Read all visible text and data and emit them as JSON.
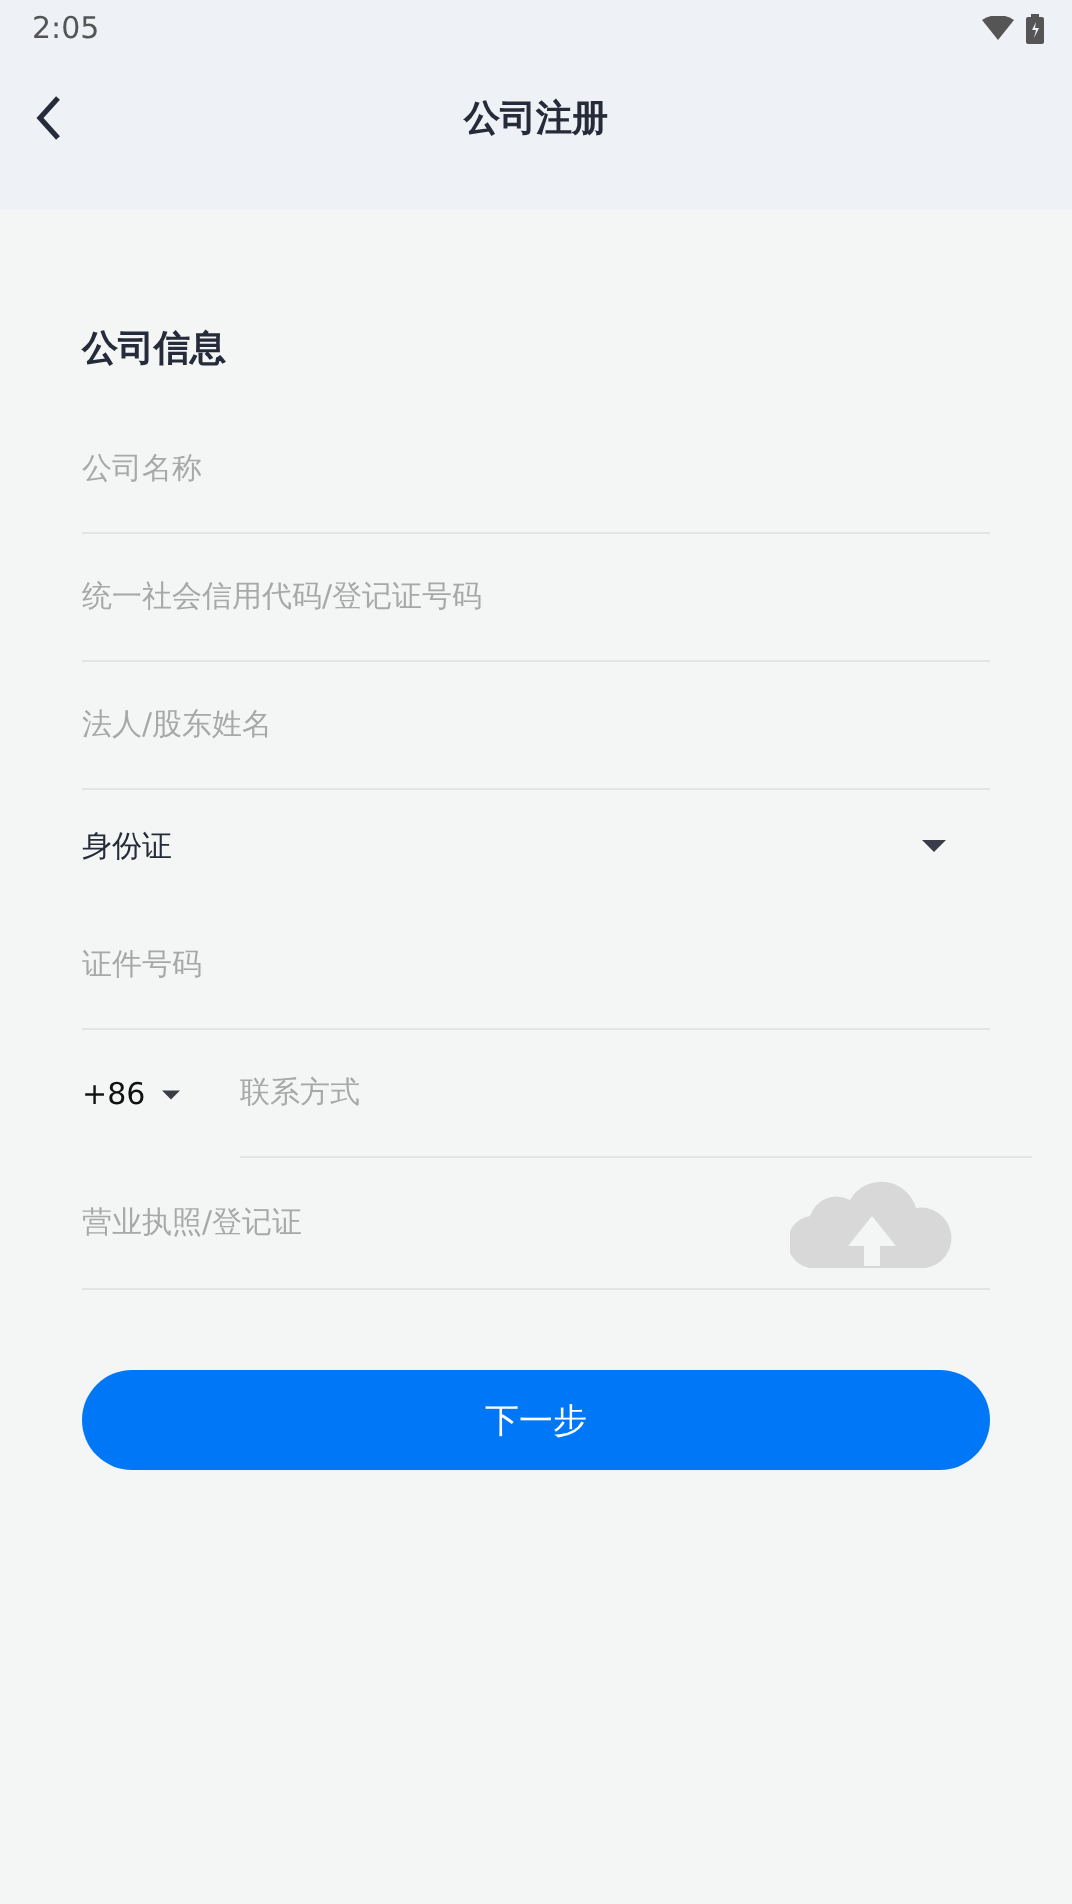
{
  "status_bar": {
    "time": "2:05"
  },
  "header": {
    "title": "公司注册"
  },
  "section": {
    "title": "公司信息"
  },
  "fields": [
    {
      "kind": "text",
      "placeholder": "公司名称"
    },
    {
      "kind": "text",
      "placeholder": "统一社会信用代码/登记证号码"
    },
    {
      "kind": "text",
      "placeholder": "法人/股东姓名"
    },
    {
      "kind": "select",
      "value": "身份证"
    },
    {
      "kind": "text",
      "placeholder": "证件号码"
    },
    {
      "kind": "phone",
      "code": "+86",
      "placeholder": "联系方式"
    },
    {
      "kind": "upload",
      "label": "营业执照/登记证"
    }
  ],
  "submit": {
    "label": "下一步"
  }
}
